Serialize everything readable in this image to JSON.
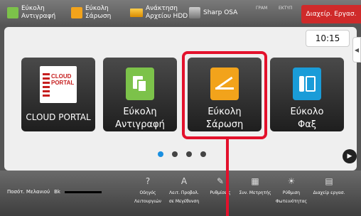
{
  "topbar": {
    "items": [
      {
        "label": "Εύκολη\nΑντιγραφή",
        "icon": "copy-icon"
      },
      {
        "label": "Εύκολη\nΣάρωση",
        "icon": "scan-icon"
      },
      {
        "label": "Ανάκτηση\nΑρχείου HDD",
        "icon": "archive-icon"
      },
      {
        "label": "Sharp OSA",
        "icon": "osa-icon"
      }
    ],
    "status_gram": "ΓΡΑΜ",
    "status_ektyp": "ΕΚΤΥΠ",
    "job_status_button": "Διαχείρ. Εργασ."
  },
  "clock": "10:15",
  "tiles": [
    {
      "label": "CLOUD PORTAL",
      "icon": "cloud-portal-icon",
      "logo_text": "CLOUD\nPORTAL"
    },
    {
      "label": "Εύκολη\nΑντιγραφή",
      "icon": "easy-copy-icon"
    },
    {
      "label": "Εύκολη\nΣάρωση",
      "icon": "easy-scan-icon"
    },
    {
      "label": "Εύκολο\nΦαξ",
      "icon": "easy-fax-icon"
    }
  ],
  "pager": {
    "pages": 4,
    "active": 1
  },
  "bottombar": {
    "toner_label": "Ποσότ. Μελανιού",
    "toner_color": "Bk",
    "items": [
      {
        "label": "Οδηγός\nΛειτουργιών",
        "icon": "guide-icon"
      },
      {
        "label": "Λειτ. Προβολ.\nσε Μεγέθυνση",
        "icon": "zoom-display-icon"
      },
      {
        "label": "Ρυθμίσεις",
        "icon": "settings-icon"
      },
      {
        "label": "Συν. Μετρητής",
        "icon": "counter-icon"
      },
      {
        "label": "Ρύθμιση\nΦωτεινότητας",
        "icon": "brightness-icon"
      },
      {
        "label": "Διαχείρ εργασ.",
        "icon": "job-status-icon"
      }
    ]
  },
  "colors": {
    "highlight": "#e3112c",
    "copy": "#7cc24a",
    "scan": "#f2a31b",
    "fax": "#1a9cd8",
    "job_button": "#cf2a2a"
  }
}
